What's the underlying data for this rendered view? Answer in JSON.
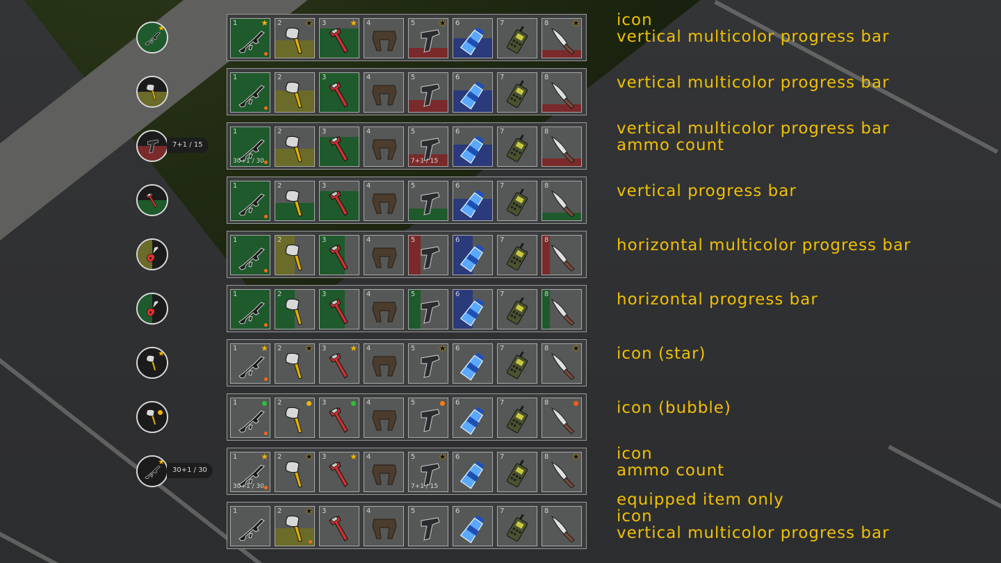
{
  "colors": {
    "label": "#f0c000",
    "green": "#1f5a2c",
    "olive": "#6b6b2a",
    "red": "#7a2a2a",
    "blue": "#2a3a7a",
    "star_orange": "#f0b400",
    "dot_orange": "#ff6a1a"
  },
  "slots": [
    {
      "number": "1",
      "icon": "rifle-icon"
    },
    {
      "number": "2",
      "icon": "axe-icon"
    },
    {
      "number": "3",
      "icon": "wrench-icon"
    },
    {
      "number": "4",
      "icon": "belt-icon"
    },
    {
      "number": "5",
      "icon": "pistol-icon"
    },
    {
      "number": "6",
      "icon": "water-bottle-icon"
    },
    {
      "number": "7",
      "icon": "walkie-talkie-icon"
    },
    {
      "number": "8",
      "icon": "knife-icon"
    }
  ],
  "rows": [
    {
      "labels": [
        "icon",
        "vertical multicolor progress bar"
      ],
      "circle": {
        "icon": "rifle-icon",
        "top": "#1f5a2c",
        "bottom": "#1f5a2c",
        "star": true
      },
      "fills": [
        {
          "mode": "v",
          "level": 1,
          "color": "#1f5a2c"
        },
        {
          "mode": "v",
          "level": 0.45,
          "color": "#6b6b2a"
        },
        {
          "mode": "v",
          "level": 0.75,
          "color": "#1f5a2c"
        },
        null,
        {
          "mode": "v",
          "level": 0.25,
          "color": "#7a2a2a"
        },
        {
          "mode": "v",
          "level": 0.5,
          "color": "#2a3a7a"
        },
        null,
        {
          "mode": "v",
          "level": 0.2,
          "color": "#7a2a2a"
        }
      ],
      "stars": [
        "orange",
        "dark",
        "orange",
        null,
        "dark",
        null,
        null,
        "dark"
      ],
      "odot": [
        true,
        false,
        false,
        false,
        false,
        false,
        false,
        false
      ]
    },
    {
      "labels": [
        "vertical multicolor progress bar"
      ],
      "circle": {
        "icon": "axe-icon",
        "top": "#1b1b1b",
        "bottom": "#6b6b2a"
      },
      "fills": [
        {
          "mode": "v",
          "level": 1,
          "color": "#1f5a2c"
        },
        {
          "mode": "v",
          "level": 0.55,
          "color": "#6b6b2a"
        },
        {
          "mode": "v",
          "level": 1,
          "color": "#1f5a2c"
        },
        null,
        {
          "mode": "v",
          "level": 0.3,
          "color": "#7a2a2a"
        },
        {
          "mode": "v",
          "level": 0.55,
          "color": "#2a3a7a"
        },
        null,
        {
          "mode": "v",
          "level": 0.2,
          "color": "#7a2a2a"
        }
      ],
      "odot": [
        true,
        false,
        false,
        false,
        false,
        false,
        false,
        false
      ]
    },
    {
      "labels": [
        "vertical multicolor progress bar",
        "ammo count"
      ],
      "circle": {
        "icon": "pistol-icon",
        "top": "#1b1b1b",
        "bottom": "#7a2a2a",
        "ammo": "7+1 / 15"
      },
      "fills": [
        {
          "mode": "v",
          "level": 1,
          "color": "#1f5a2c"
        },
        {
          "mode": "v",
          "level": 0.45,
          "color": "#6b6b2a"
        },
        {
          "mode": "v",
          "level": 0.75,
          "color": "#1f5a2c"
        },
        null,
        {
          "mode": "v",
          "level": 0.3,
          "color": "#7a2a2a"
        },
        {
          "mode": "v",
          "level": 0.55,
          "color": "#2a3a7a"
        },
        null,
        {
          "mode": "v",
          "level": 0.2,
          "color": "#7a2a2a"
        }
      ],
      "ammo": [
        "30+1 / 30",
        null,
        null,
        null,
        "7+1 / 15",
        null,
        null,
        null
      ],
      "odot": [
        true,
        false,
        false,
        false,
        false,
        false,
        false,
        false
      ]
    },
    {
      "labels": [
        "vertical progress bar"
      ],
      "circle": {
        "icon": "wrench-icon",
        "top": "#1b1b1b",
        "bottom": "#1f5a2c"
      },
      "fills": [
        {
          "mode": "v",
          "level": 1,
          "color": "#1f5a2c"
        },
        {
          "mode": "v",
          "level": 0.45,
          "color": "#1f5a2c"
        },
        {
          "mode": "v",
          "level": 0.75,
          "color": "#1f5a2c"
        },
        null,
        {
          "mode": "v",
          "level": 0.3,
          "color": "#1f5a2c"
        },
        {
          "mode": "v",
          "level": 0.55,
          "color": "#2a3a7a"
        },
        null,
        {
          "mode": "v",
          "level": 0.2,
          "color": "#1f5a2c"
        }
      ],
      "odot": [
        true,
        false,
        false,
        false,
        false,
        false,
        false,
        false
      ]
    },
    {
      "labels": [
        "horizontal multicolor progress bar"
      ],
      "circle": {
        "icon": "guitar-icon",
        "top": "#6b6b2a",
        "bottom": "#6b6b2a",
        "half": "left"
      },
      "fills": [
        {
          "mode": "h",
          "level": 1,
          "color": "#1f5a2c"
        },
        {
          "mode": "h",
          "level": 0.5,
          "color": "#6b6b2a"
        },
        {
          "mode": "h",
          "level": 0.65,
          "color": "#1f5a2c"
        },
        null,
        {
          "mode": "h",
          "level": 0.3,
          "color": "#7a2a2a"
        },
        {
          "mode": "h",
          "level": 0.5,
          "color": "#2a3a7a"
        },
        null,
        {
          "mode": "h",
          "level": 0.2,
          "color": "#7a2a2a"
        }
      ],
      "odot": [
        true,
        false,
        false,
        false,
        false,
        false,
        false,
        false
      ]
    },
    {
      "labels": [
        "horizontal progress bar"
      ],
      "circle": {
        "icon": "guitar-icon",
        "top": "#1f5a2c",
        "bottom": "#1f5a2c",
        "half": "left"
      },
      "fills": [
        {
          "mode": "h",
          "level": 1,
          "color": "#1f5a2c"
        },
        {
          "mode": "h",
          "level": 0.5,
          "color": "#1f5a2c"
        },
        {
          "mode": "h",
          "level": 0.65,
          "color": "#1f5a2c"
        },
        null,
        {
          "mode": "h",
          "level": 0.3,
          "color": "#1f5a2c"
        },
        {
          "mode": "h",
          "level": 0.5,
          "color": "#2a3a7a"
        },
        null,
        {
          "mode": "h",
          "level": 0.2,
          "color": "#1f5a2c"
        }
      ],
      "odot": [
        true,
        false,
        false,
        false,
        false,
        false,
        false,
        false
      ]
    },
    {
      "labels": [
        "icon (star)"
      ],
      "circle": {
        "icon": "axe-icon",
        "top": "#1b1b1b",
        "bottom": "#1b1b1b",
        "star": true
      },
      "fills": [
        null,
        null,
        null,
        null,
        null,
        null,
        null,
        null
      ],
      "stars": [
        "orange",
        "dark",
        "orange",
        null,
        "dark",
        null,
        null,
        "dark"
      ],
      "odot": [
        true,
        false,
        false,
        false,
        false,
        false,
        false,
        false
      ]
    },
    {
      "labels": [
        "icon (bubble)"
      ],
      "circle": {
        "icon": "axe-icon",
        "top": "#1b1b1b",
        "bottom": "#1b1b1b",
        "bubble": true
      },
      "fills": [
        null,
        null,
        null,
        null,
        null,
        null,
        null,
        null
      ],
      "bubbles": [
        "#2fbf3a",
        "#f0b400",
        "#2fbf3a",
        null,
        "#ff7a1a",
        null,
        null,
        "#ff5a1a"
      ],
      "odot": [
        true,
        false,
        false,
        false,
        false,
        false,
        false,
        false
      ]
    },
    {
      "labels": [
        "icon",
        "ammo count"
      ],
      "circle": {
        "icon": "rifle-icon",
        "top": "#1b1b1b",
        "bottom": "#1b1b1b",
        "star": true,
        "ammo": "30+1 / 30"
      },
      "fills": [
        null,
        null,
        null,
        null,
        null,
        null,
        null,
        null
      ],
      "stars": [
        "orange",
        "dark",
        "orange",
        null,
        "dark",
        null,
        null,
        "dark"
      ],
      "ammo": [
        "30+1 / 30",
        null,
        null,
        null,
        "7+1 / 15",
        null,
        null,
        null
      ],
      "odot": [
        true,
        false,
        false,
        false,
        false,
        false,
        false,
        false
      ]
    },
    {
      "labels": [
        "equipped item only",
        "icon",
        "vertical multicolor progress bar"
      ],
      "circle": null,
      "fills": [
        null,
        {
          "mode": "v",
          "level": 0.45,
          "color": "#6b6b2a"
        },
        null,
        null,
        null,
        null,
        null,
        null
      ],
      "stars": [
        null,
        "dark",
        null,
        null,
        null,
        null,
        null,
        null
      ],
      "odot": [
        false,
        true,
        false,
        false,
        false,
        false,
        false,
        false
      ]
    }
  ]
}
